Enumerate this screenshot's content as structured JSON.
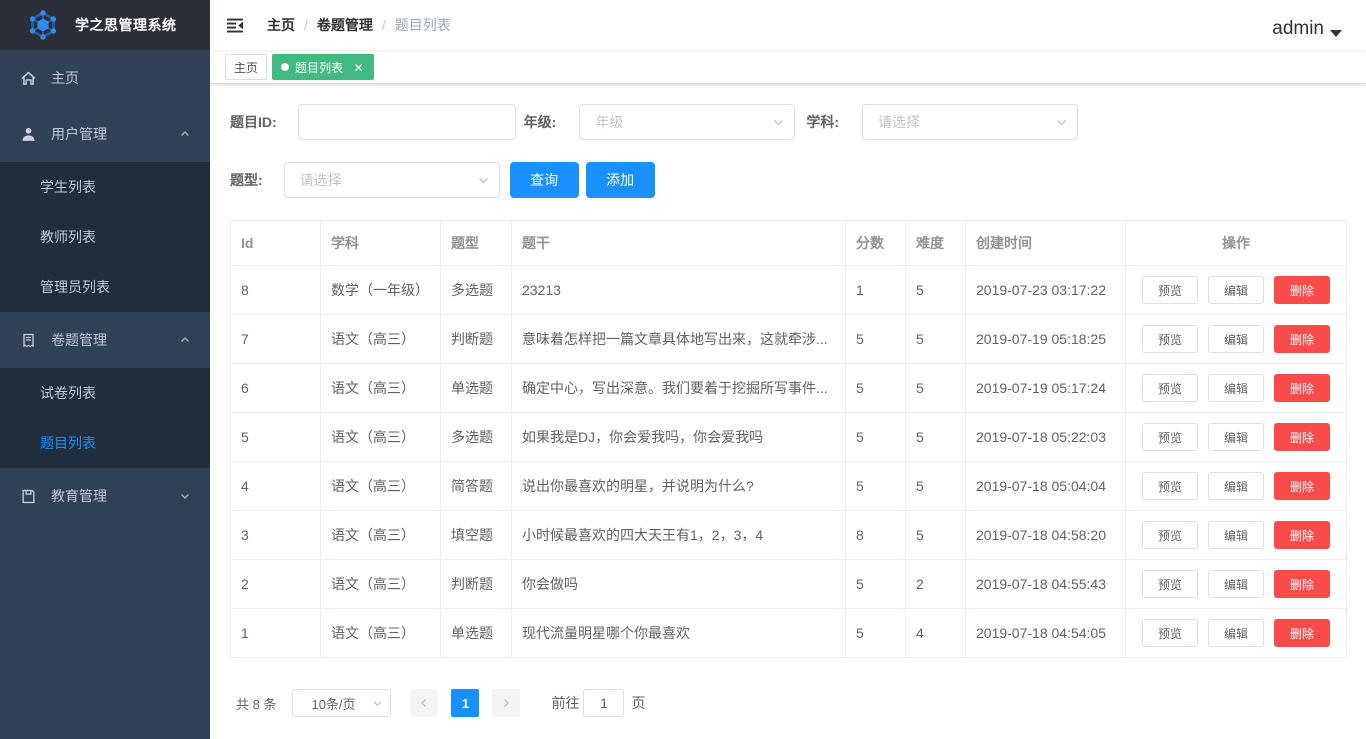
{
  "app": {
    "title": "学之思管理系统"
  },
  "sidebar": {
    "items": [
      {
        "label": "主页",
        "icon": "home"
      },
      {
        "label": "用户管理",
        "icon": "user",
        "expanded": true,
        "children": [
          {
            "label": "学生列表"
          },
          {
            "label": "教师列表"
          },
          {
            "label": "管理员列表"
          }
        ]
      },
      {
        "label": "卷题管理",
        "icon": "document",
        "expanded": true,
        "children": [
          {
            "label": "试卷列表"
          },
          {
            "label": "题目列表",
            "active": true
          }
        ]
      },
      {
        "label": "教育管理",
        "icon": "education",
        "expanded": false
      }
    ]
  },
  "navbar": {
    "breadcrumb": [
      "主页",
      "卷题管理",
      "题目列表"
    ],
    "separator": "/",
    "user": "admin"
  },
  "tags": [
    {
      "label": "主页",
      "active": false
    },
    {
      "label": "题目列表",
      "active": true,
      "closable": true
    }
  ],
  "filters": {
    "id_label": "题目ID:",
    "grade_label": "年级:",
    "grade_placeholder": "年级",
    "subject_label": "学科:",
    "subject_placeholder": "请选择",
    "type_label": "题型:",
    "type_placeholder": "请选择",
    "id_value": "",
    "search_button": "查询",
    "add_button": "添加"
  },
  "table": {
    "columns": [
      "Id",
      "学科",
      "题型",
      "题干",
      "分数",
      "难度",
      "创建时间",
      "操作"
    ],
    "actions": {
      "preview": "预览",
      "edit": "编辑",
      "delete": "删除"
    },
    "rows": [
      {
        "id": "8",
        "subject": "数学（一年级）",
        "type": "多选题",
        "stem": "23213",
        "score": "1",
        "difficulty": "5",
        "created": "2019-07-23 03:17:22"
      },
      {
        "id": "7",
        "subject": "语文（高三）",
        "type": "判断题",
        "stem": "意味着怎样把一篇文章具体地写出来，这就牵涉...",
        "score": "5",
        "difficulty": "5",
        "created": "2019-07-19 05:18:25"
      },
      {
        "id": "6",
        "subject": "语文（高三）",
        "type": "单选题",
        "stem": "确定中心，写出深意。我们要着于挖掘所写事件...",
        "score": "5",
        "difficulty": "5",
        "created": "2019-07-19 05:17:24"
      },
      {
        "id": "5",
        "subject": "语文（高三）",
        "type": "多选题",
        "stem": "如果我是DJ，你会爱我吗，你会爱我吗",
        "score": "5",
        "difficulty": "5",
        "created": "2019-07-18 05:22:03"
      },
      {
        "id": "4",
        "subject": "语文（高三）",
        "type": "简答题",
        "stem": "说出你最喜欢的明星，并说明为什么?",
        "score": "5",
        "difficulty": "5",
        "created": "2019-07-18 05:04:04"
      },
      {
        "id": "3",
        "subject": "语文（高三）",
        "type": "填空题",
        "stem": "小时候最喜欢的四大天王有1，2，3，4",
        "score": "8",
        "difficulty": "5",
        "created": "2019-07-18 04:58:20"
      },
      {
        "id": "2",
        "subject": "语文（高三）",
        "type": "判断题",
        "stem": "你会做吗",
        "score": "5",
        "difficulty": "2",
        "created": "2019-07-18 04:55:43"
      },
      {
        "id": "1",
        "subject": "语文（高三）",
        "type": "单选题",
        "stem": "现代流量明星哪个你最喜欢",
        "score": "5",
        "difficulty": "4",
        "created": "2019-07-18 04:54:05"
      }
    ]
  },
  "pagination": {
    "total_text": "共 8 条",
    "page_size": "10条/页",
    "current_page": "1",
    "jump_prefix": "前往",
    "jump_value": "1",
    "jump_suffix": "页"
  },
  "colors": {
    "primary_blue": "#1890ff",
    "danger_red": "#fa4b4b",
    "active_tag_green": "#42b983",
    "sidebar_bg": "#304156",
    "sidebar_sub_bg": "#1f2d3d",
    "logo_bg": "#2b2f3a",
    "sidebar_text": "#bfcbd9",
    "table_border": "#ebeef5"
  }
}
